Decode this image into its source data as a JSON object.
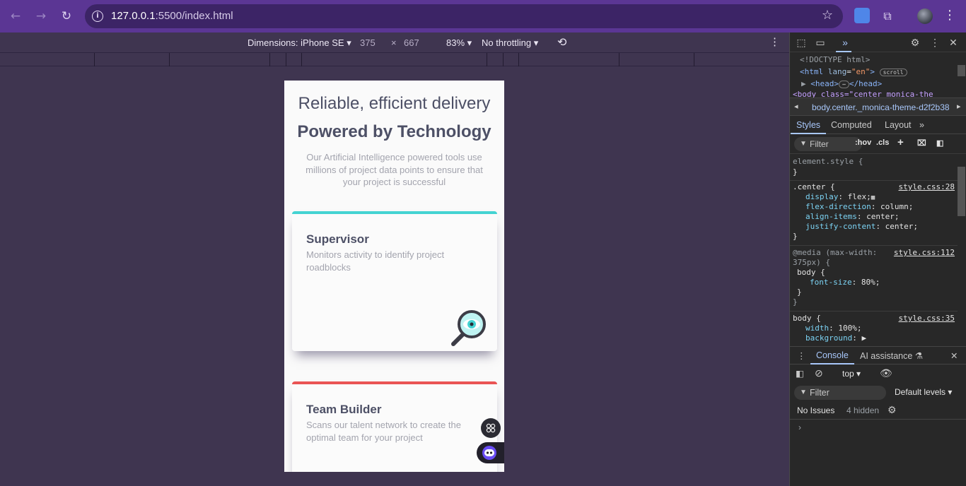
{
  "browser": {
    "url_host": "127.0.0.1",
    "url_path": ":5500/index.html",
    "back_icon": "back-arrow-icon",
    "forward_icon": "forward-arrow-icon",
    "reload_icon": "reload-icon",
    "accent": "#5b3694"
  },
  "device_toolbar": {
    "dimensions_label": "Dimensions: iPhone SE",
    "width": "375",
    "times": "×",
    "height": "667",
    "zoom": "83%",
    "throttling": "No throttling"
  },
  "page": {
    "hero_subtitle": "Reliable, efficient delivery",
    "hero_title": "Powered by Technology",
    "hero_description": "Our Artificial Intelligence powered tools use millions of project data points to ensure that your project is successful",
    "cards": [
      {
        "title": "Supervisor",
        "description": "Monitors activity to identify project roadblocks",
        "accent": "#44d3d2"
      },
      {
        "title": "Team Builder",
        "description": "Scans our talent network to create the optimal team for your project",
        "accent": "#ea5454"
      }
    ]
  },
  "devtools": {
    "elements": {
      "doctype": "<!DOCTYPE html>",
      "html_tag": "<html",
      "html_attr": "lang",
      "html_val": "\"en\"",
      "html_close": ">",
      "scroll_pill": "scroll",
      "head_open": "<head>",
      "ellipsis": "⋯",
      "head_close": "</head>",
      "body_line": "<body class=\"center  monica-the"
    },
    "breadcrumb": "body.center._monica-theme-d2f2b38",
    "tabs": [
      "Styles",
      "Computed",
      "Layout"
    ],
    "filter_placeholder": "Filter",
    "hov": ":hov",
    "cls": ".cls",
    "styles": {
      "element_style": "element.style {",
      "close": "}",
      "center_selector": ".center {",
      "center_source": "style.css:28",
      "center_props": [
        {
          "name": "display",
          "value": "flex;"
        },
        {
          "name": "flex-direction",
          "value": "column;"
        },
        {
          "name": "align-items",
          "value": "center;"
        },
        {
          "name": "justify-content",
          "value": "center;"
        }
      ],
      "media_query_1": "@media (max-width:",
      "media_query_2": "375px) {",
      "media_source": "style.css:112",
      "media_body": "body {",
      "media_prop": "font-size",
      "media_val": "80%;",
      "body_selector": "body {",
      "body_source": "style.css:35",
      "body_props": [
        {
          "name": "width",
          "value": "100%;"
        },
        {
          "name": "background",
          "value": "▶"
        }
      ]
    },
    "console": {
      "tab": "Console",
      "ai_tab": "AI assistance",
      "context": "top",
      "filter_placeholder": "Filter",
      "levels": "Default levels",
      "no_issues": "No Issues",
      "hidden": "4 hidden",
      "prompt": "›"
    }
  }
}
